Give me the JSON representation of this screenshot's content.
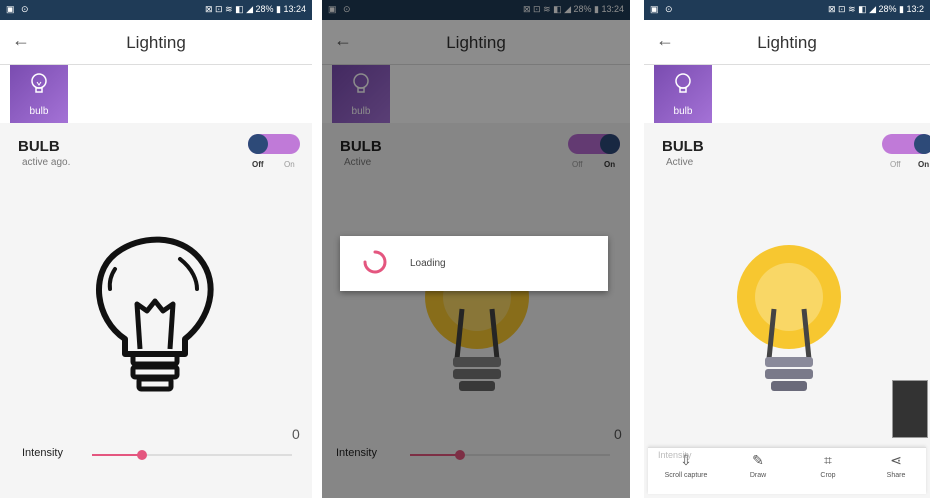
{
  "colors": {
    "status_bar": "#1f3b57",
    "tile": "#8a5bc4",
    "toggle_track": "#c07ad8",
    "toggle_knob": "#2d4a78",
    "slider": "#e4567f",
    "bulb_on": "#f7c730"
  },
  "screen1": {
    "status_left": "▣ ⊙",
    "status_right": "⊠ ⊡ ≋ ◧ ◢ 28% ▮ 13:24",
    "title": "Lighting",
    "back_icon": "arrow-left-icon",
    "tile_label": "bulb",
    "device_name": "BULB",
    "device_status": "active ago.",
    "toggle_off": "Off",
    "toggle_on": "On",
    "intensity_value": "0",
    "intensity_label": "Intensity",
    "intensity_fraction": 0.25
  },
  "screen2": {
    "status_left": "▣ ⊙",
    "status_right": "⊠ ⊡ ≋ ◧ ◢ 28% ▮ 13:24",
    "title": "Lighting",
    "tile_label": "bulb",
    "device_name": "BULB",
    "device_status": "Active",
    "toggle_off": "Off",
    "toggle_on": "On",
    "loading_text": "Loading",
    "intensity_value": "0",
    "intensity_label": "Intensity",
    "intensity_fraction": 0.25
  },
  "screen3": {
    "status_left": "▣ ⊙",
    "status_right": "⊠ ⊡ ≋ ◧ ◢ 28% ▮ 13:2",
    "title": "Lighting",
    "tile_label": "bulb",
    "device_name": "BULB",
    "device_status": "Active",
    "toggle_off": "Off",
    "toggle_on": "On",
    "intensity_label": "Intensity",
    "share_items": [
      {
        "label": "Scroll capture",
        "icon": "scroll-capture-icon",
        "glyph": "⇩"
      },
      {
        "label": "Draw",
        "icon": "draw-icon",
        "glyph": "✎"
      },
      {
        "label": "Crop",
        "icon": "crop-icon",
        "glyph": "⌗"
      },
      {
        "label": "Share",
        "icon": "share-icon",
        "glyph": "⋖"
      }
    ]
  }
}
